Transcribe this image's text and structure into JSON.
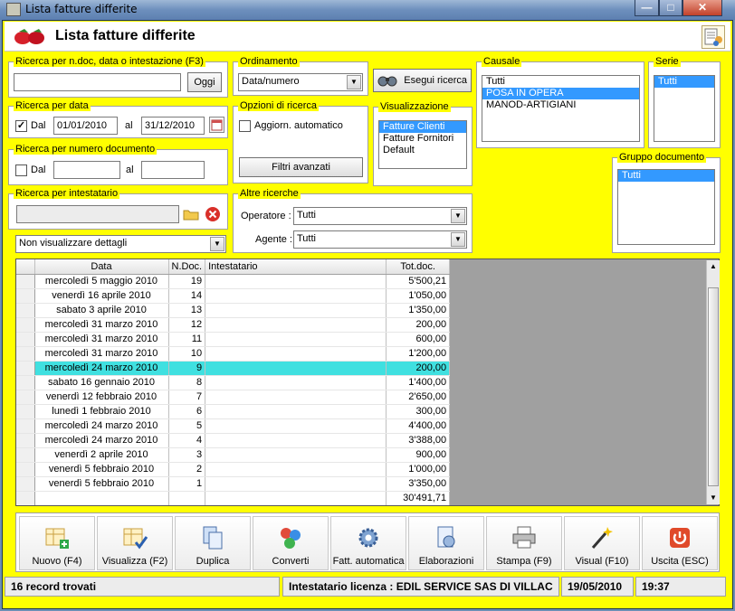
{
  "window": {
    "title": "Lista fatture differite",
    "min_label": "—",
    "max_label": "□",
    "close_label": "✕"
  },
  "header": {
    "title": "Lista fatture differite"
  },
  "search_ndoc": {
    "label": "Ricerca per n.doc, data o intestazione (F3)",
    "value": "",
    "today_label": "Oggi"
  },
  "search_date": {
    "label": "Ricerca per data",
    "dal_label": "Dal",
    "dal_checked": "✓",
    "from": "01/01/2010",
    "al_label": "al",
    "to": "31/12/2010"
  },
  "search_number": {
    "label": "Ricerca per numero documento",
    "dal_label": "Dal",
    "from": "",
    "al_label": "al",
    "to": ""
  },
  "search_owner": {
    "label": "Ricerca per intestatario",
    "value": ""
  },
  "details_combo": {
    "value": "Non visualizzare dettagli"
  },
  "ordering": {
    "label": "Ordinamento",
    "value": "Data/numero"
  },
  "search_button": {
    "label": "Esegui ricerca"
  },
  "options": {
    "label": "Opzioni di ricerca",
    "auto_label": "Aggiorn. automatico",
    "filters_label": "Filtri avanzati"
  },
  "view": {
    "label": "Visualizzazione",
    "items": [
      "Fatture Clienti",
      "Fatture Fornitori",
      "Default"
    ],
    "selected": 0
  },
  "other": {
    "label": "Altre ricerche",
    "operator_label": "Operatore :",
    "operator_value": "Tutti",
    "agent_label": "Agente :",
    "agent_value": "Tutti"
  },
  "causale": {
    "label": "Causale",
    "items": [
      "Tutti",
      "POSA IN OPERA",
      "MANOD-ARTIGIANI"
    ],
    "selected": 1
  },
  "serie": {
    "label": "Serie",
    "items": [
      "Tutti"
    ],
    "selected": 0
  },
  "gruppo": {
    "label": "Gruppo documento",
    "items": [
      "Tutti"
    ],
    "selected": 0
  },
  "table": {
    "columns": [
      "Data",
      "N.Doc.",
      "Intestatario",
      "Tot.doc."
    ],
    "rows": [
      {
        "date": "mercoledì 5 maggio 2010",
        "ndoc": "19",
        "owner": "",
        "total": "5'500,21"
      },
      {
        "date": "venerdì 16 aprile 2010",
        "ndoc": "14",
        "owner": "",
        "total": "1'050,00"
      },
      {
        "date": "sabato 3 aprile 2010",
        "ndoc": "13",
        "owner": "",
        "total": "1'350,00"
      },
      {
        "date": "mercoledì 31 marzo 2010",
        "ndoc": "12",
        "owner": "",
        "total": "200,00"
      },
      {
        "date": "mercoledì 31 marzo 2010",
        "ndoc": "11",
        "owner": "",
        "total": "600,00"
      },
      {
        "date": "mercoledì 31 marzo 2010",
        "ndoc": "10",
        "owner": "",
        "total": "1'200,00"
      },
      {
        "date": "mercoledì 24 marzo 2010",
        "ndoc": "9",
        "owner": "",
        "total": "200,00"
      },
      {
        "date": "sabato 16 gennaio 2010",
        "ndoc": "8",
        "owner": "",
        "total": "1'400,00"
      },
      {
        "date": "venerdì 12 febbraio 2010",
        "ndoc": "7",
        "owner": "",
        "total": "2'650,00"
      },
      {
        "date": "lunedì 1 febbraio 2010",
        "ndoc": "6",
        "owner": "",
        "total": "300,00"
      },
      {
        "date": "mercoledì 24 marzo 2010",
        "ndoc": "5",
        "owner": "",
        "total": "4'400,00"
      },
      {
        "date": "mercoledì 24 marzo 2010",
        "ndoc": "4",
        "owner": "",
        "total": "3'388,00"
      },
      {
        "date": "venerdì 2 aprile 2010",
        "ndoc": "3",
        "owner": "",
        "total": "900,00"
      },
      {
        "date": "venerdì 5 febbraio 2010",
        "ndoc": "2",
        "owner": "",
        "total": "1'000,00"
      },
      {
        "date": "venerdì 5 febbraio 2010",
        "ndoc": "1",
        "owner": "",
        "total": "3'350,00"
      }
    ],
    "highlighted_row": 6,
    "grand_total": "30'491,71"
  },
  "toolbar": {
    "buttons": [
      {
        "id": "nuovo",
        "label": "Nuovo (F4)",
        "icon": "new-document-icon"
      },
      {
        "id": "visualizza",
        "label": "Visualizza (F2)",
        "icon": "view-grid-icon"
      },
      {
        "id": "duplica",
        "label": "Duplica",
        "icon": "duplicate-icon"
      },
      {
        "id": "converti",
        "label": "Converti",
        "icon": "convert-icon"
      },
      {
        "id": "fatt-auto",
        "label": "Fatt. automatica",
        "icon": "gear-icon"
      },
      {
        "id": "elaborazioni",
        "label": "Elaborazioni",
        "icon": "process-icon"
      },
      {
        "id": "stampa",
        "label": "Stampa (F9)",
        "icon": "printer-icon"
      },
      {
        "id": "visual",
        "label": "Visual (F10)",
        "icon": "magic-wand-icon"
      },
      {
        "id": "uscita",
        "label": "Uscita (ESC)",
        "icon": "power-icon"
      }
    ]
  },
  "status": {
    "records": "16 record trovati",
    "license": "Intestatario licenza : EDIL SERVICE SAS DI VILLAC",
    "date": "19/05/2010",
    "time": "19:37"
  }
}
